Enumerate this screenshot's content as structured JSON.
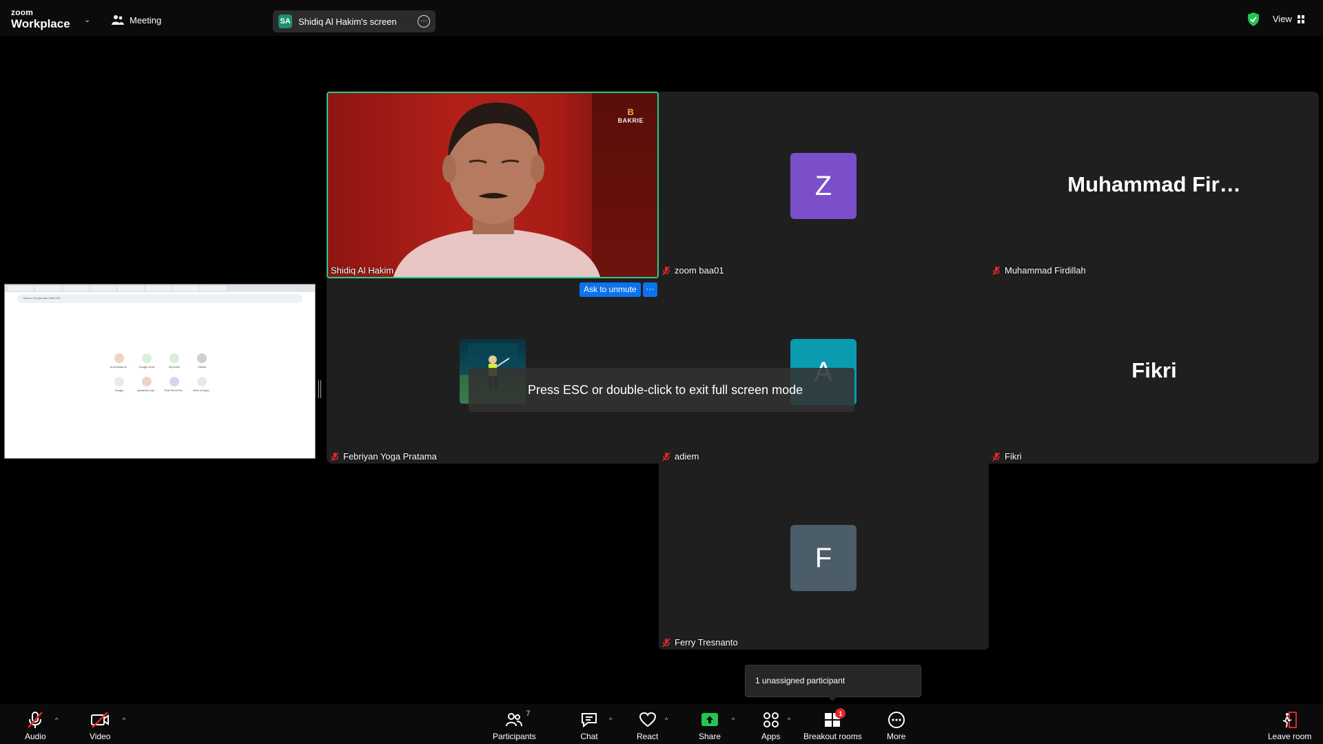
{
  "app": {
    "brand_small": "zoom",
    "brand_large": "Workplace",
    "meeting_label": "Meeting",
    "screen_initials": "SA",
    "screen_label": "Shidiq Al Hakim's screen",
    "view_label": "View"
  },
  "tiles": {
    "video_name": "Shidiq Al Hakim",
    "video_logo_letter": "B",
    "video_logo_text": "BAKRIE",
    "zoom_initial": "Z",
    "zoom_name": "zoom baa01",
    "firdillah_display": "Muhammad  Fir…",
    "firdillah_name": "Muhammad Firdillah",
    "febriyan_name": "Febriyan Yoga Pratama",
    "adiem_initial": "A",
    "adiem_name": "adiem",
    "fikri_display": "Fikri",
    "fikri_name": "Fikri",
    "ferry_initial": "F",
    "ferry_name": "Ferry Tresnanto"
  },
  "colors": {
    "zoom_avatar": "#7a4fc9",
    "adiem_avatar": "#0a9bb1",
    "ferry_avatar": "#4c5d6a",
    "active_border": "#23d18b",
    "primary_blue": "#0e72ed"
  },
  "overlays": {
    "ask_unmute": "Ask to unmute",
    "ask_more": "···",
    "fullscreen_toast": "Press ESC or double-click to exit full screen mode",
    "unassigned": "1 unassigned participant"
  },
  "thumbnail": {
    "url_placeholder": "Telusuri Google atau ketik URL",
    "shortcuts": [
      "Universitas B...",
      "Google Drive",
      "My Drive",
      "GitHub",
      "Google",
      "academic.bak...",
      "Post Test 8 Re...",
      "View of Impa..."
    ]
  },
  "toolbar": {
    "audio": "Audio",
    "video": "Video",
    "participants": "Participants",
    "participants_count": "7",
    "chat": "Chat",
    "react": "React",
    "share": "Share",
    "apps": "Apps",
    "breakout": "Breakout rooms",
    "breakout_badge": "1",
    "more": "More",
    "leave": "Leave room",
    "caret": "^"
  }
}
